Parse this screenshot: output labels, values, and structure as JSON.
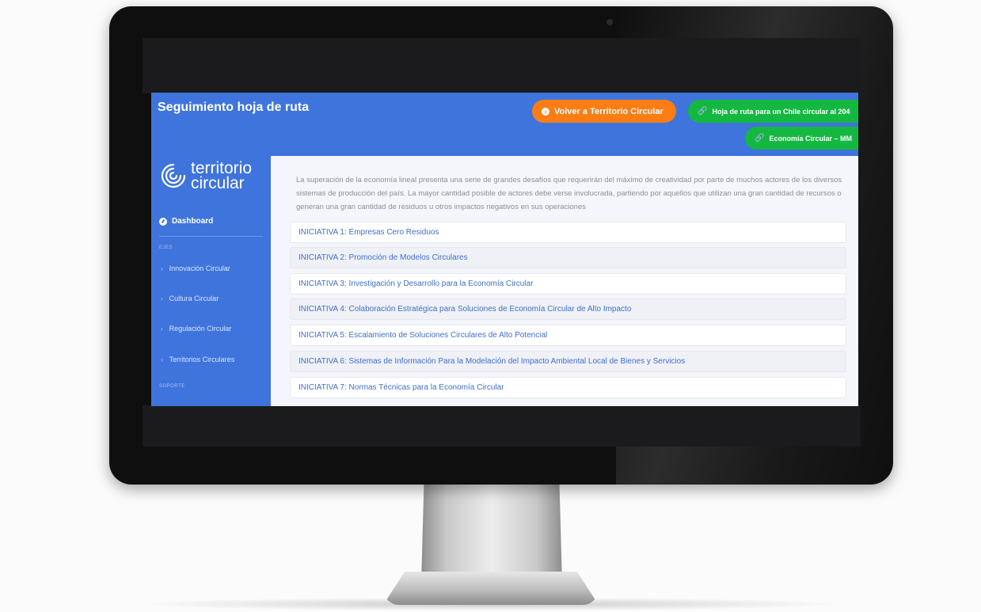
{
  "header": {
    "title": "Seguimiento hoja de ruta",
    "back_button": "Volver a Territorio Circular",
    "link_roadmap": "Hoja de ruta para un Chile circular al 204",
    "link_economy": "Economía Circular – MM"
  },
  "sidebar": {
    "logo_line1": "territorio",
    "logo_line2": "circular",
    "dashboard": "Dashboard",
    "section_ejes": "EJES",
    "items": [
      {
        "label": "Innovación Circular"
      },
      {
        "label": "Cultura Circular"
      },
      {
        "label": "Regulación Circular"
      },
      {
        "label": "Territorios Circulares"
      }
    ],
    "section_soporte": "SOPORTE"
  },
  "main": {
    "intro": "La superación de la economía lineal presenta una serie de grandes desafíos que requerirán del máximo de creatividad por parte de muchos actores de los diversos sistemas de producción del país. La mayor cantidad posible de actores debe verse involucrada, partiendo por aquellos que utilizan una gran cantidad de recursos o generan una gran cantidad de residuos u otros impactos negativos en sus operaciones",
    "initiatives": [
      {
        "label": "INICIATIVA 1: Empresas Cero Residuos"
      },
      {
        "label": "INICIATIVA 2: Promoción de Modelos Circulares"
      },
      {
        "label": "INICIATIVA 3: Investigación y Desarrollo para la Economía Circular"
      },
      {
        "label": "INICIATIVA 4: Colaboración Estratégica para Soluciones de Economía Circular de Alto Impacto"
      },
      {
        "label": "INICIATIVA 5: Escalamiento de Soluciones Circulares de Alto Potencial"
      },
      {
        "label": "INICIATIVA 6: Sistemas de Información Para la Modelación del Impacto Ambiental Local de Bienes y Servicios"
      },
      {
        "label": "INICIATIVA 7: Normas Técnicas para la Economía Circular"
      }
    ]
  },
  "colors": {
    "primary_blue": "#3f74dc",
    "orange": "#fb7d14",
    "green": "#14b841",
    "link_blue": "#3f6fc9"
  },
  "icons": {
    "back": "arrow-circle-left-icon",
    "link": "link-icon",
    "dashboard": "gauge-icon",
    "chevron": "chevron-right-icon",
    "logo": "spiral-logo-icon"
  }
}
